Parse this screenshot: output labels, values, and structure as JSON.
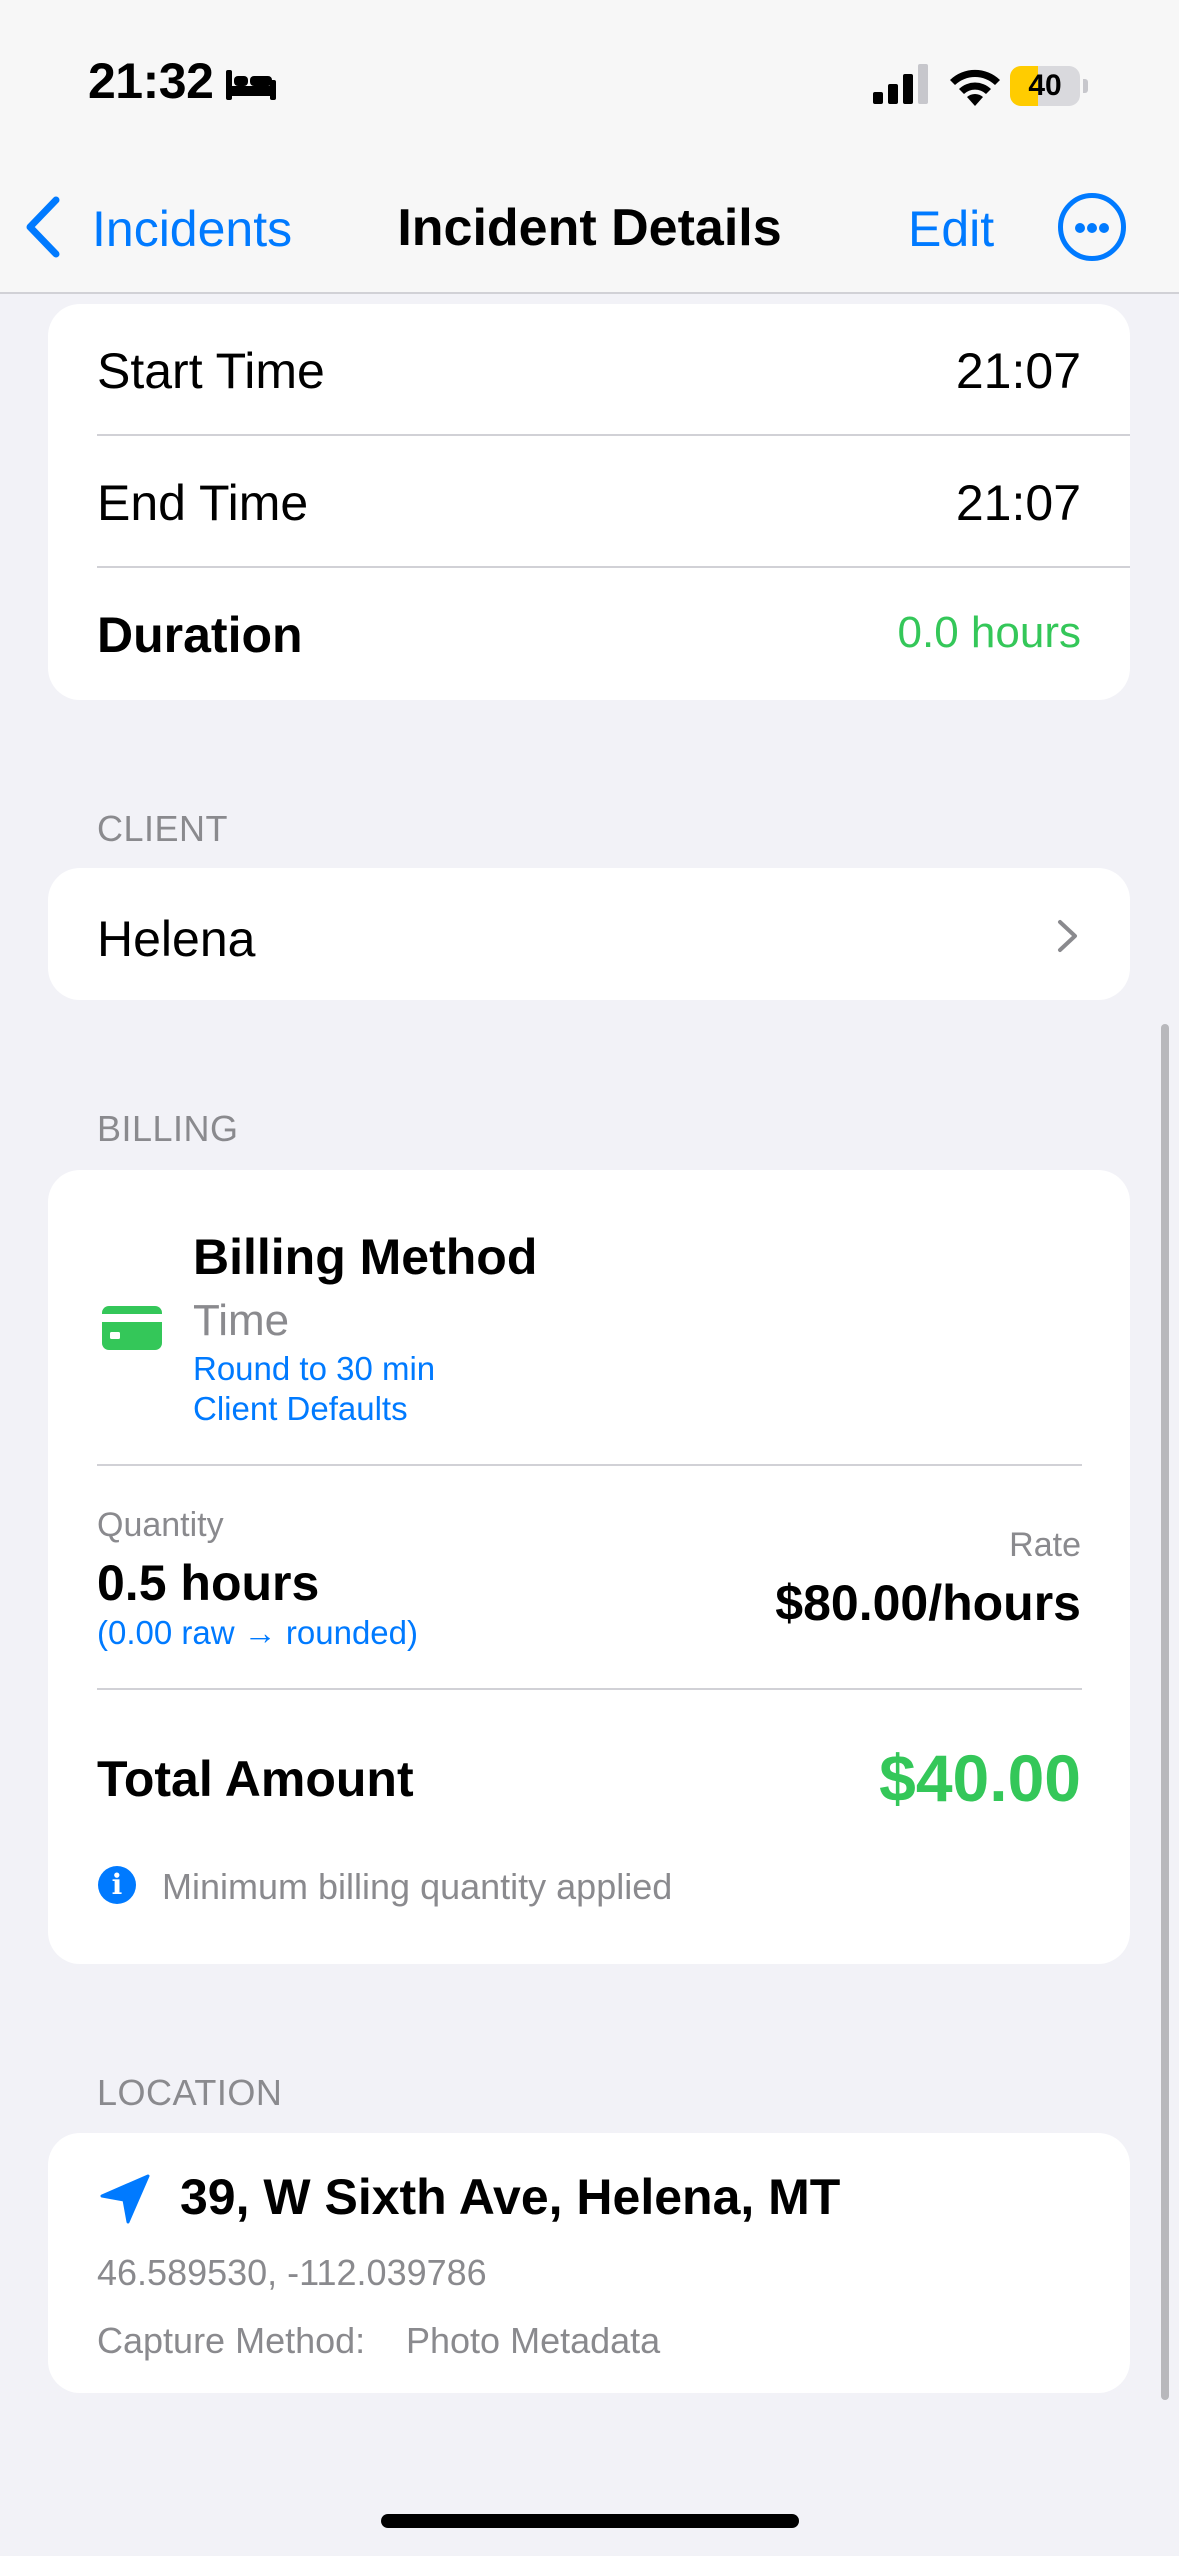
{
  "status_bar": {
    "time": "21:32",
    "battery": "40",
    "battery_level_pct": 40
  },
  "nav": {
    "back_label": "Incidents",
    "title": "Incident Details",
    "edit_label": "Edit"
  },
  "time_section": {
    "start_label": "Start Time",
    "start_value": "21:07",
    "end_label": "End Time",
    "end_value": "21:07",
    "duration_label": "Duration",
    "duration_value": "0.0 hours"
  },
  "client_section": {
    "header": "CLIENT",
    "name": "Helena"
  },
  "billing_section": {
    "header": "BILLING",
    "method_title": "Billing Method",
    "method_value": "Time",
    "round_link": "Round to 30 min",
    "defaults_link": "Client Defaults",
    "quantity_label": "Quantity",
    "quantity_value": "0.5 hours",
    "quantity_note": "(0.00 raw → rounded)",
    "rate_label": "Rate",
    "rate_value": "$80.00/hours",
    "total_label": "Total Amount",
    "total_value": "$40.00",
    "info_text": "Minimum billing quantity applied"
  },
  "location_section": {
    "header": "LOCATION",
    "address": "39, W Sixth Ave, Helena, MT",
    "coordinates": "46.589530, -112.039786",
    "capture_label": "Capture Method:",
    "capture_value": "Photo Metadata"
  },
  "colors": {
    "accent": "#007aff",
    "green": "#34c759",
    "battery_yellow": "#ffcc00"
  },
  "icons": [
    "bed-icon",
    "cellular-signal-icon",
    "wifi-icon",
    "battery-icon",
    "back-chevron-icon",
    "more-icon",
    "chevron-right-icon",
    "credit-card-icon",
    "info-icon",
    "location-arrow-icon"
  ]
}
